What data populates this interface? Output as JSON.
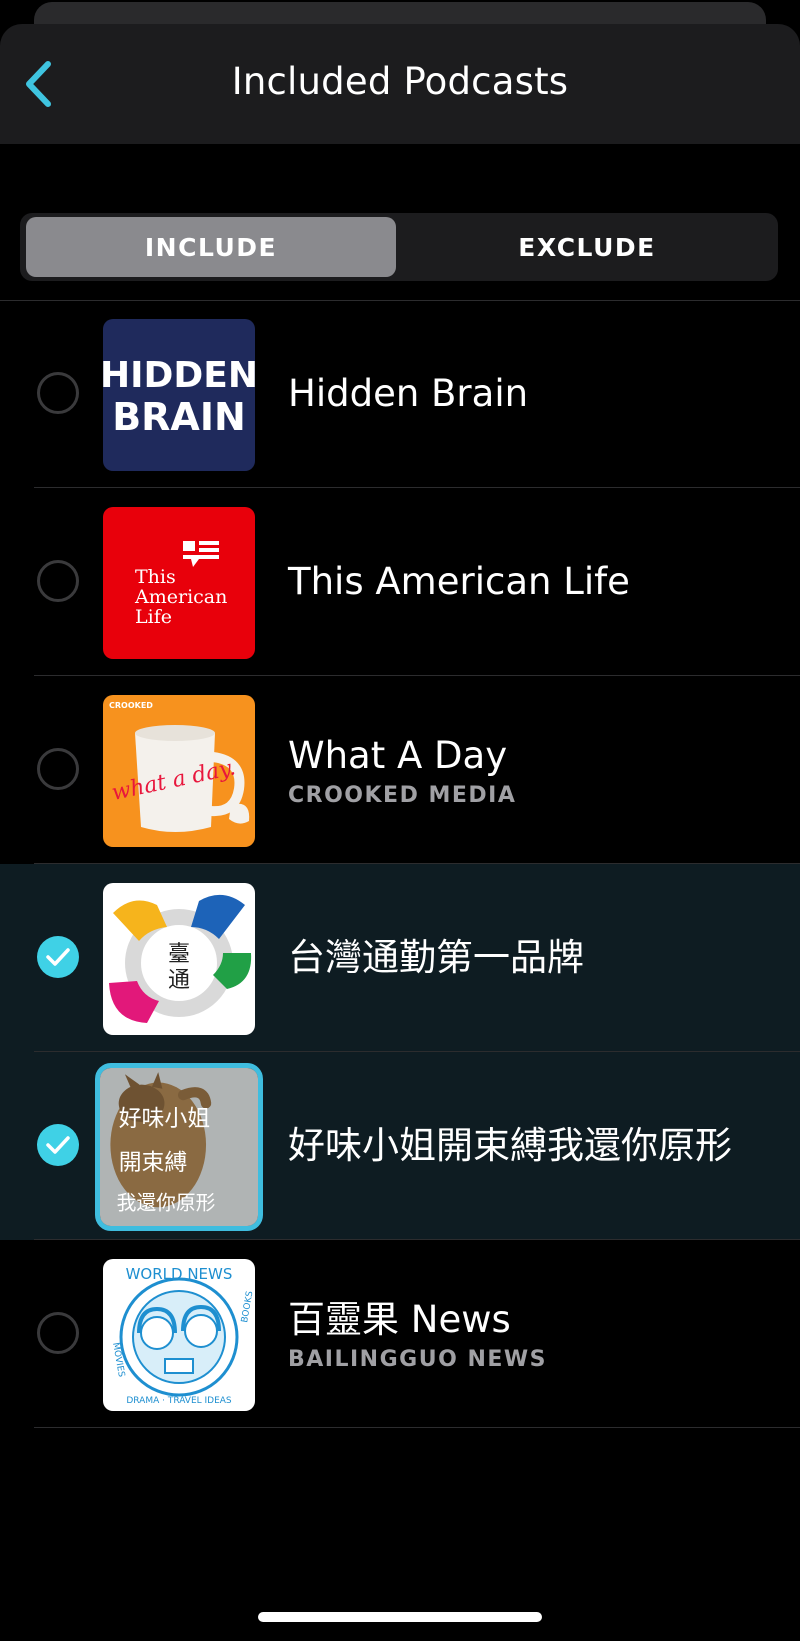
{
  "header": {
    "title": "Included Podcasts",
    "back_icon": "chevron-left-icon",
    "accent_color": "#3fc4e0"
  },
  "segmented": {
    "include_label": "INCLUDE",
    "exclude_label": "EXCLUDE",
    "selected": "INCLUDE"
  },
  "podcasts": [
    {
      "name": "Hidden Brain",
      "subtitle": "",
      "selected": false,
      "art": {
        "text_line1": "HIDDEN",
        "text_line2": "BRAIN",
        "bg": "#1f2a5c"
      }
    },
    {
      "name": "This American Life",
      "subtitle": "",
      "selected": false,
      "art": {
        "line1": "This",
        "line2": "American",
        "line3": "Life",
        "bg": "#e8000b"
      }
    },
    {
      "name": "What A Day",
      "subtitle": "CROOKED MEDIA",
      "selected": false,
      "art": {
        "mug_text": "what a day.",
        "brand": "CROOKED",
        "bg": "#f7921e"
      }
    },
    {
      "name": "台灣通勤第一品牌",
      "subtitle": "",
      "selected": true,
      "art": {
        "chars_top": "臺",
        "chars_bottom": "通",
        "bg": "#ffffff"
      }
    },
    {
      "name": "好味小姐開束縛我還你原形",
      "subtitle": "",
      "selected": true,
      "focused": true,
      "art": {
        "script_line1": "好味小姐",
        "script_line2": "開束縛",
        "script_line3": "我還你原形"
      }
    },
    {
      "name": "百靈果 News",
      "subtitle": "BAILINGGUO NEWS",
      "selected": false,
      "art": {
        "top_text": "WORLD NEWS",
        "left_text": "MOVIES",
        "right_text": "BOOKS",
        "bottom_text": "DRAMA · TRAVEL IDEAS",
        "color": "#1e8fd0"
      }
    }
  ],
  "colors": {
    "selected_row_bg": "#0e1c22",
    "check_color": "#3fd1e6",
    "segment_active_bg": "#8a8a8e"
  }
}
